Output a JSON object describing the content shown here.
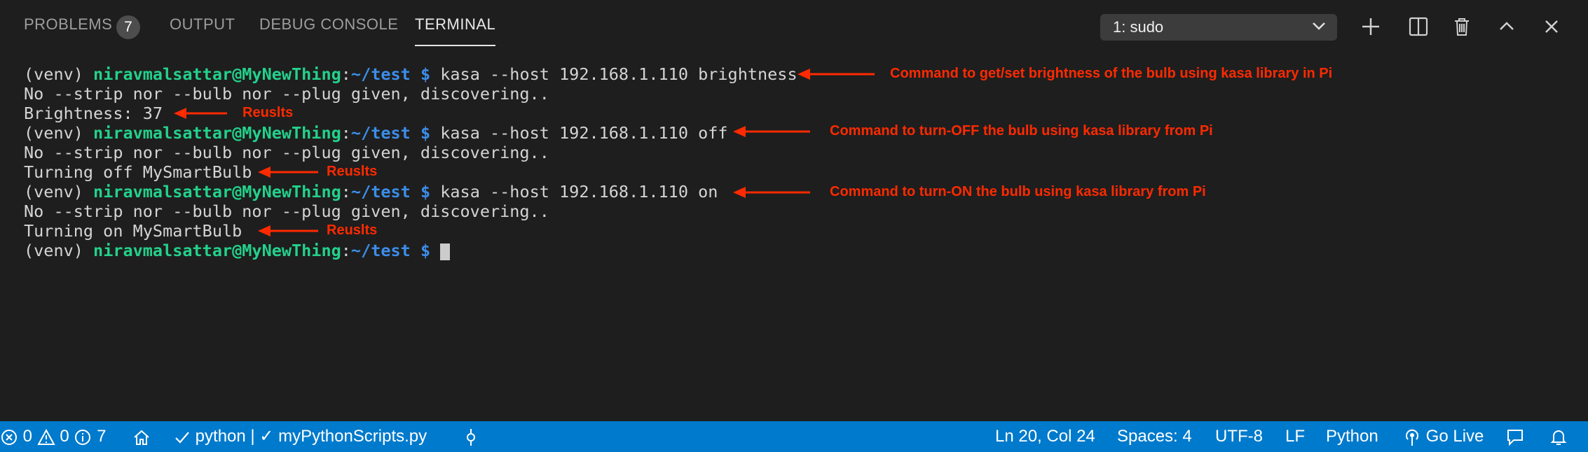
{
  "panel": {
    "tabs": [
      {
        "label": "PROBLEMS",
        "badge": "7"
      },
      {
        "label": "OUTPUT"
      },
      {
        "label": "DEBUG CONSOLE"
      },
      {
        "label": "TERMINAL"
      }
    ],
    "terminal_select": "1: sudo"
  },
  "terminal": {
    "lines": [
      {
        "venv": "(venv) ",
        "user": "niravmalsattar@MyNewThing",
        "colon": ":",
        "path": "~/test $",
        "cmd": " kasa --host 192.168.1.110 brightness"
      },
      {
        "text": "No --strip nor --bulb nor --plug given, discovering.."
      },
      {
        "text": "Brightness: 37"
      },
      {
        "venv": "(venv) ",
        "user": "niravmalsattar@MyNewThing",
        "colon": ":",
        "path": "~/test $",
        "cmd": " kasa --host 192.168.1.110 off"
      },
      {
        "text": "No --strip nor --bulb nor --plug given, discovering.."
      },
      {
        "text": "Turning off MySmartBulb"
      },
      {
        "venv": "(venv) ",
        "user": "niravmalsattar@MyNewThing",
        "colon": ":",
        "path": "~/test $",
        "cmd": " kasa --host 192.168.1.110 on"
      },
      {
        "text": "No --strip nor --bulb nor --plug given, discovering.."
      },
      {
        "text": "Turning on MySmartBulb"
      },
      {
        "venv": "(venv) ",
        "user": "niravmalsattar@MyNewThing",
        "colon": ":",
        "path": "~/test $",
        "cmd": " "
      }
    ]
  },
  "annotations": {
    "brightness_cmd": "Command to get/set brightness of the bulb using kasa library in Pi",
    "results_1": "Reuslts",
    "off_cmd": "Command to turn-OFF the bulb using kasa library from Pi",
    "results_2": "Reuslts",
    "on_cmd": "Command to turn-ON the bulb using kasa library from Pi",
    "results_3": "Reuslts",
    "color": "#ff2a00"
  },
  "statusbar": {
    "errors": "0",
    "warnings": "0",
    "infos": "7",
    "interpreter": "python | ✓ myPythonScripts.py",
    "position": "Ln 20, Col 24",
    "spaces": "Spaces: 4",
    "encoding": "UTF-8",
    "eol": "LF",
    "language": "Python",
    "golive": "Go Live",
    "color": "#007acc"
  }
}
